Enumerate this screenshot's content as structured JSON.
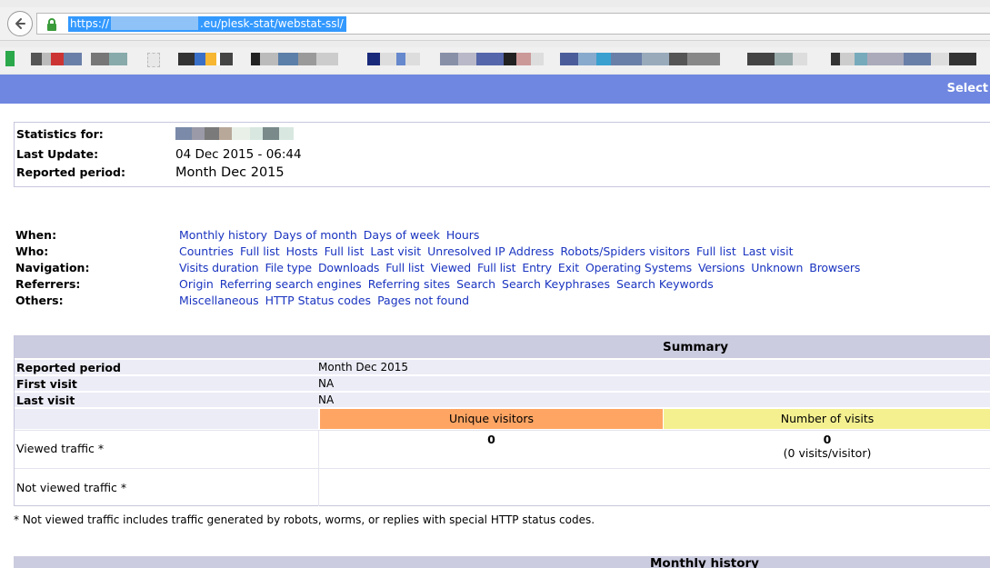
{
  "browser": {
    "url_prefix": "https://",
    "url_suffix": ".eu/plesk-stat/webstat-ssl/"
  },
  "banner": {
    "select_label": "Select"
  },
  "stats": {
    "statistics_for_label": "Statistics for:",
    "last_update_label": "Last Update:",
    "last_update_value": "04 Dec 2015 - 06:44",
    "reported_period_label": "Reported period:",
    "reported_period_value": "Month Dec 2015"
  },
  "nav": {
    "rows": [
      {
        "label": "When:",
        "links": [
          "Monthly history",
          "Days of month",
          "Days of week",
          "Hours"
        ]
      },
      {
        "label": "Who:",
        "links": [
          "Countries",
          "Full list",
          "Hosts",
          "Full list",
          "Last visit",
          "Unresolved IP Address",
          "Robots/Spiders visitors",
          "Full list",
          "Last visit"
        ]
      },
      {
        "label": "Navigation:",
        "links": [
          "Visits duration",
          "File type",
          "Downloads",
          "Full list",
          "Viewed",
          "Full list",
          "Entry",
          "Exit",
          "Operating Systems",
          "Versions",
          "Unknown",
          "Browsers"
        ]
      },
      {
        "label": "Referrers:",
        "links": [
          "Origin",
          "Referring search engines",
          "Referring sites",
          "Search",
          "Search Keyphrases",
          "Search Keywords"
        ]
      },
      {
        "label": "Others:",
        "links": [
          "Miscellaneous",
          "HTTP Status codes",
          "Pages not found"
        ]
      }
    ]
  },
  "summary": {
    "title": "Summary",
    "reported_period_label": "Reported period",
    "reported_period_value": "Month Dec 2015",
    "first_visit_label": "First visit",
    "first_visit_value": "NA",
    "last_visit_label": "Last visit",
    "last_visit_value": "NA",
    "col_unique": "Unique visitors",
    "col_visits": "Number of visits",
    "viewed_label": "Viewed traffic *",
    "viewed_unique": "0",
    "viewed_visits": "0",
    "viewed_visits_sub": "(0 visits/visitor)",
    "not_viewed_label": "Not viewed traffic *",
    "footnote": "* Not viewed traffic includes traffic generated by robots, worms, or replies with special HTTP status codes."
  },
  "monthly": {
    "title": "Monthly history"
  },
  "colors": {
    "banner": "#6f87e0",
    "header": "#cccce0",
    "unique": "#ffa564",
    "visits": "#f4f090",
    "link": "#1a34c0"
  }
}
